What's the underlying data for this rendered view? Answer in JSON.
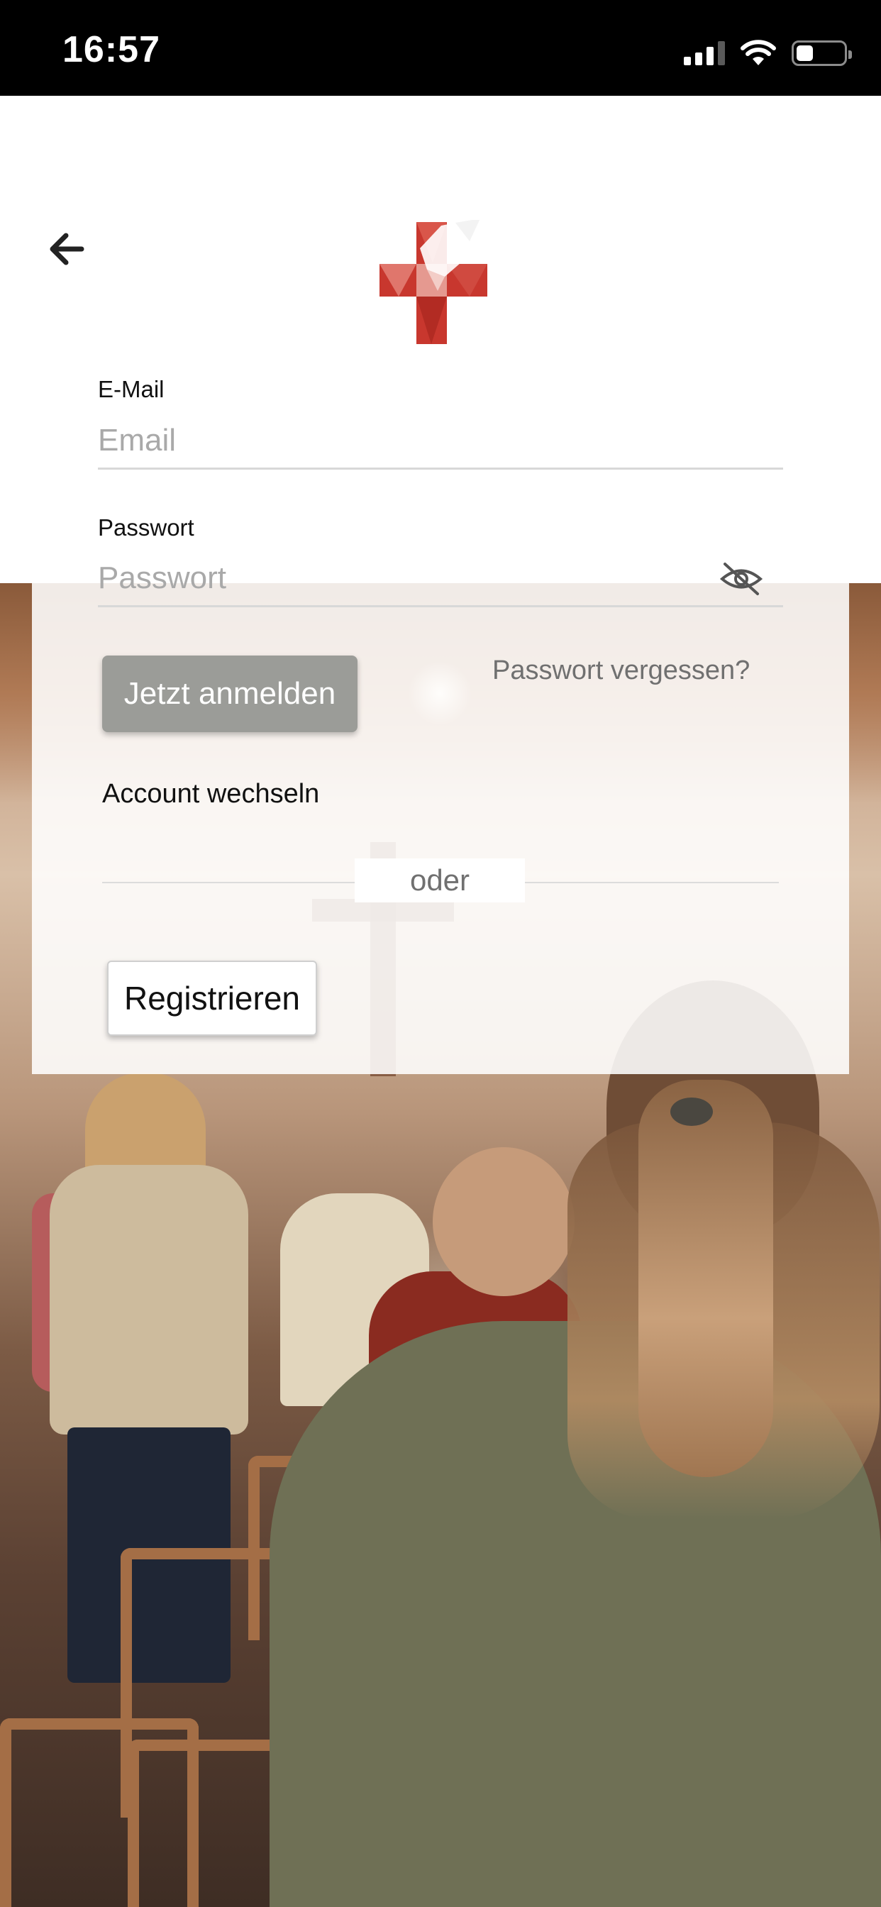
{
  "status_bar": {
    "time": "16:57",
    "icons": [
      "cellular-signal-icon",
      "wifi-icon",
      "battery-icon"
    ],
    "battery_level": 0.35
  },
  "header": {
    "back_icon": "arrow-left-icon",
    "logo_icon": "red-cross-dove-logo"
  },
  "form": {
    "email": {
      "label": "E-Mail",
      "placeholder": "Email",
      "value": ""
    },
    "password": {
      "label": "Passwort",
      "placeholder": "Passwort",
      "value": "",
      "toggle_icon": "eye-slash-icon"
    }
  },
  "actions": {
    "login_label": "Jetzt anmelden",
    "forgot_label": "Passwort vergessen?",
    "switch_account_label": "Account wechseln",
    "divider_label": "oder",
    "register_label": "Registrieren"
  },
  "colors": {
    "login_button": "#9b9c98",
    "logo_red": "#c8372e",
    "muted_text": "#707070"
  }
}
